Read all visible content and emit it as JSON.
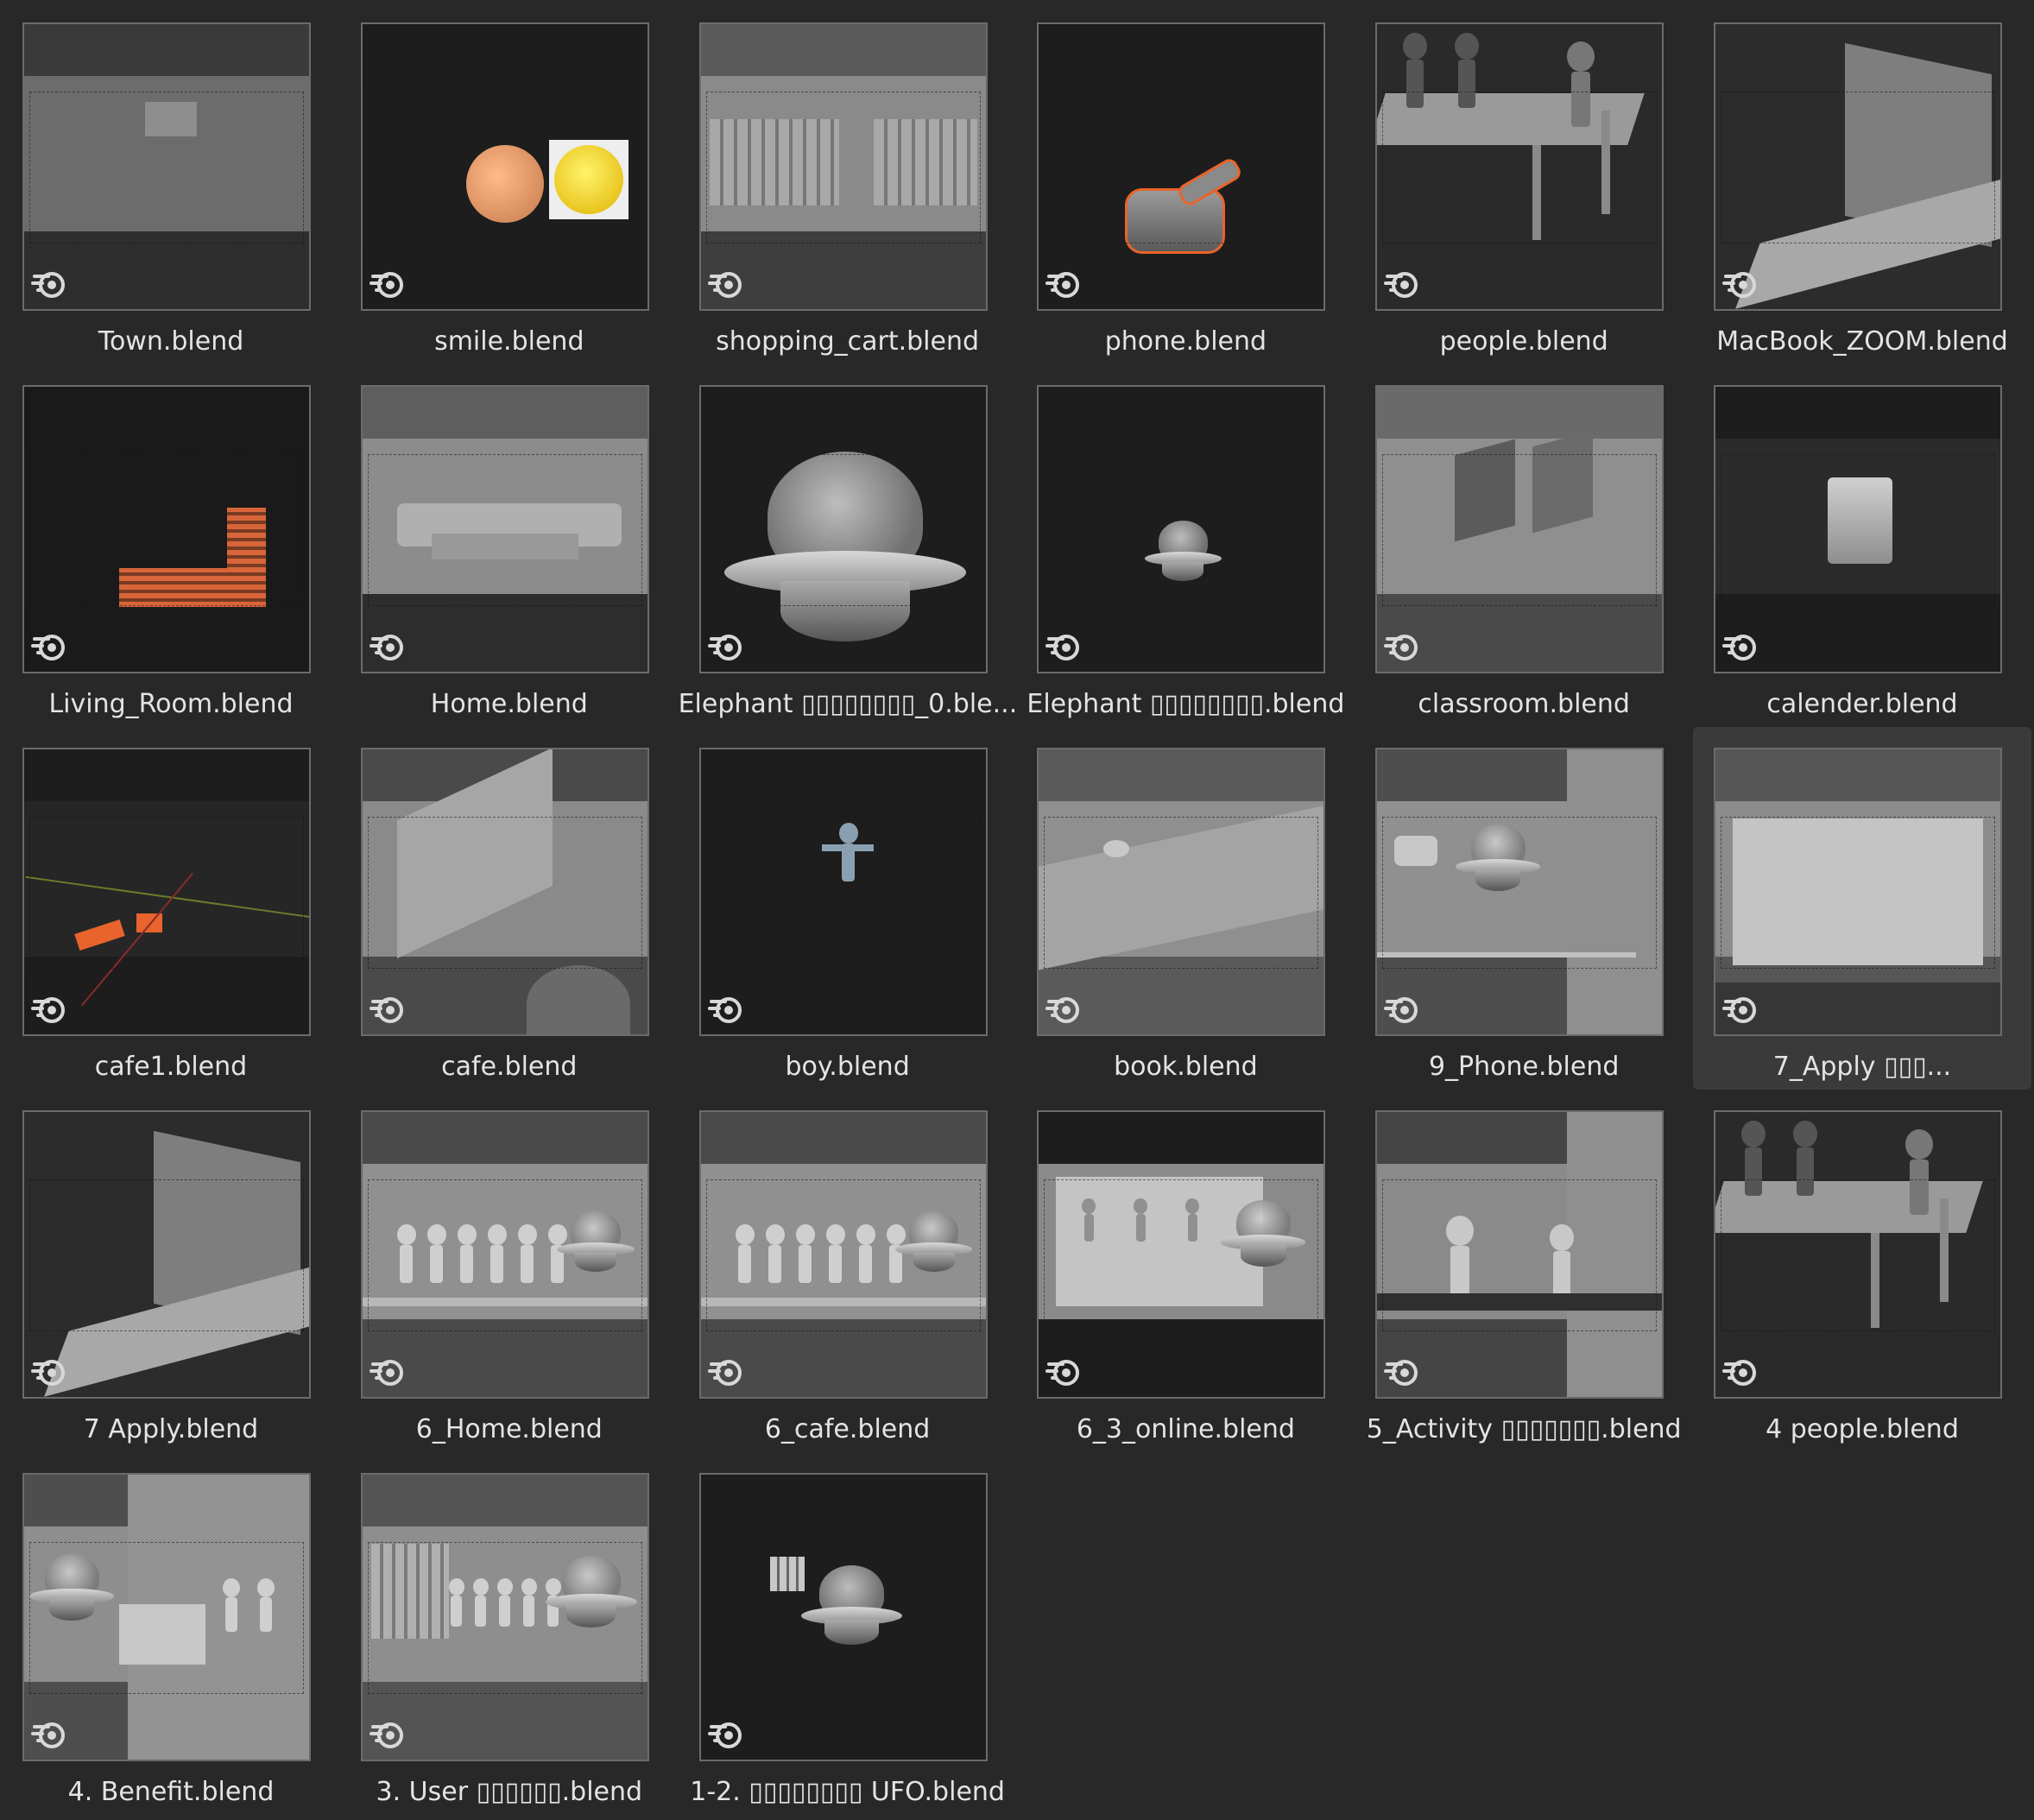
{
  "files": [
    {
      "name": "Town.blend",
      "thumb": "town"
    },
    {
      "name": "smile.blend",
      "thumb": "smile"
    },
    {
      "name": "shopping_cart.blend",
      "thumb": "cart"
    },
    {
      "name": "phone.blend",
      "thumb": "phone"
    },
    {
      "name": "people.blend",
      "thumb": "people"
    },
    {
      "name": "MacBook_ZOOM.blend",
      "thumb": "laptop"
    },
    {
      "name": "Living_Room.blend",
      "thumb": "living"
    },
    {
      "name": "Home.blend",
      "thumb": "home"
    },
    {
      "name": "Elephant ▯▯▯▯▯▯▯▯_0.ble...",
      "thumb": "ufo-big"
    },
    {
      "name": "Elephant ▯▯▯▯▯▯▯▯.blend",
      "thumb": "ufo-small"
    },
    {
      "name": "classroom.blend",
      "thumb": "classroom"
    },
    {
      "name": "calender.blend",
      "thumb": "calendar"
    },
    {
      "name": "cafe1.blend",
      "thumb": "cafe1"
    },
    {
      "name": "cafe.blend",
      "thumb": "cafe"
    },
    {
      "name": "boy.blend",
      "thumb": "boy"
    },
    {
      "name": "book.blend",
      "thumb": "book"
    },
    {
      "name": "9_Phone.blend",
      "thumb": "phone9"
    },
    {
      "name": "7_Apply ▯▯▯...",
      "thumb": "apply7",
      "selected": true
    },
    {
      "name": "7 Apply.blend",
      "thumb": "laptop2"
    },
    {
      "name": "6_Home.blend",
      "thumb": "crowd"
    },
    {
      "name": "6_cafe.blend",
      "thumb": "crowd2"
    },
    {
      "name": "6_3_online.blend",
      "thumb": "online"
    },
    {
      "name": "5_Activity ▯▯▯▯▯▯▯.blend",
      "thumb": "activity"
    },
    {
      "name": "4 people.blend",
      "thumb": "people"
    },
    {
      "name": "4. Benefit.blend",
      "thumb": "benefit"
    },
    {
      "name": "3. User ▯▯▯▯▯▯.blend",
      "thumb": "user"
    },
    {
      "name": "1-2. ▯▯▯▯▯▯▯▯ UFO.blend",
      "thumb": "ufo-books"
    }
  ],
  "icon": "blender-file-icon",
  "colors": {
    "background": "#282828",
    "thumb_border": "#6b6b6b",
    "selection_orange": "#e8642c",
    "label_text": "#e4e4e4",
    "selected_tile": "#3a3a3a"
  }
}
